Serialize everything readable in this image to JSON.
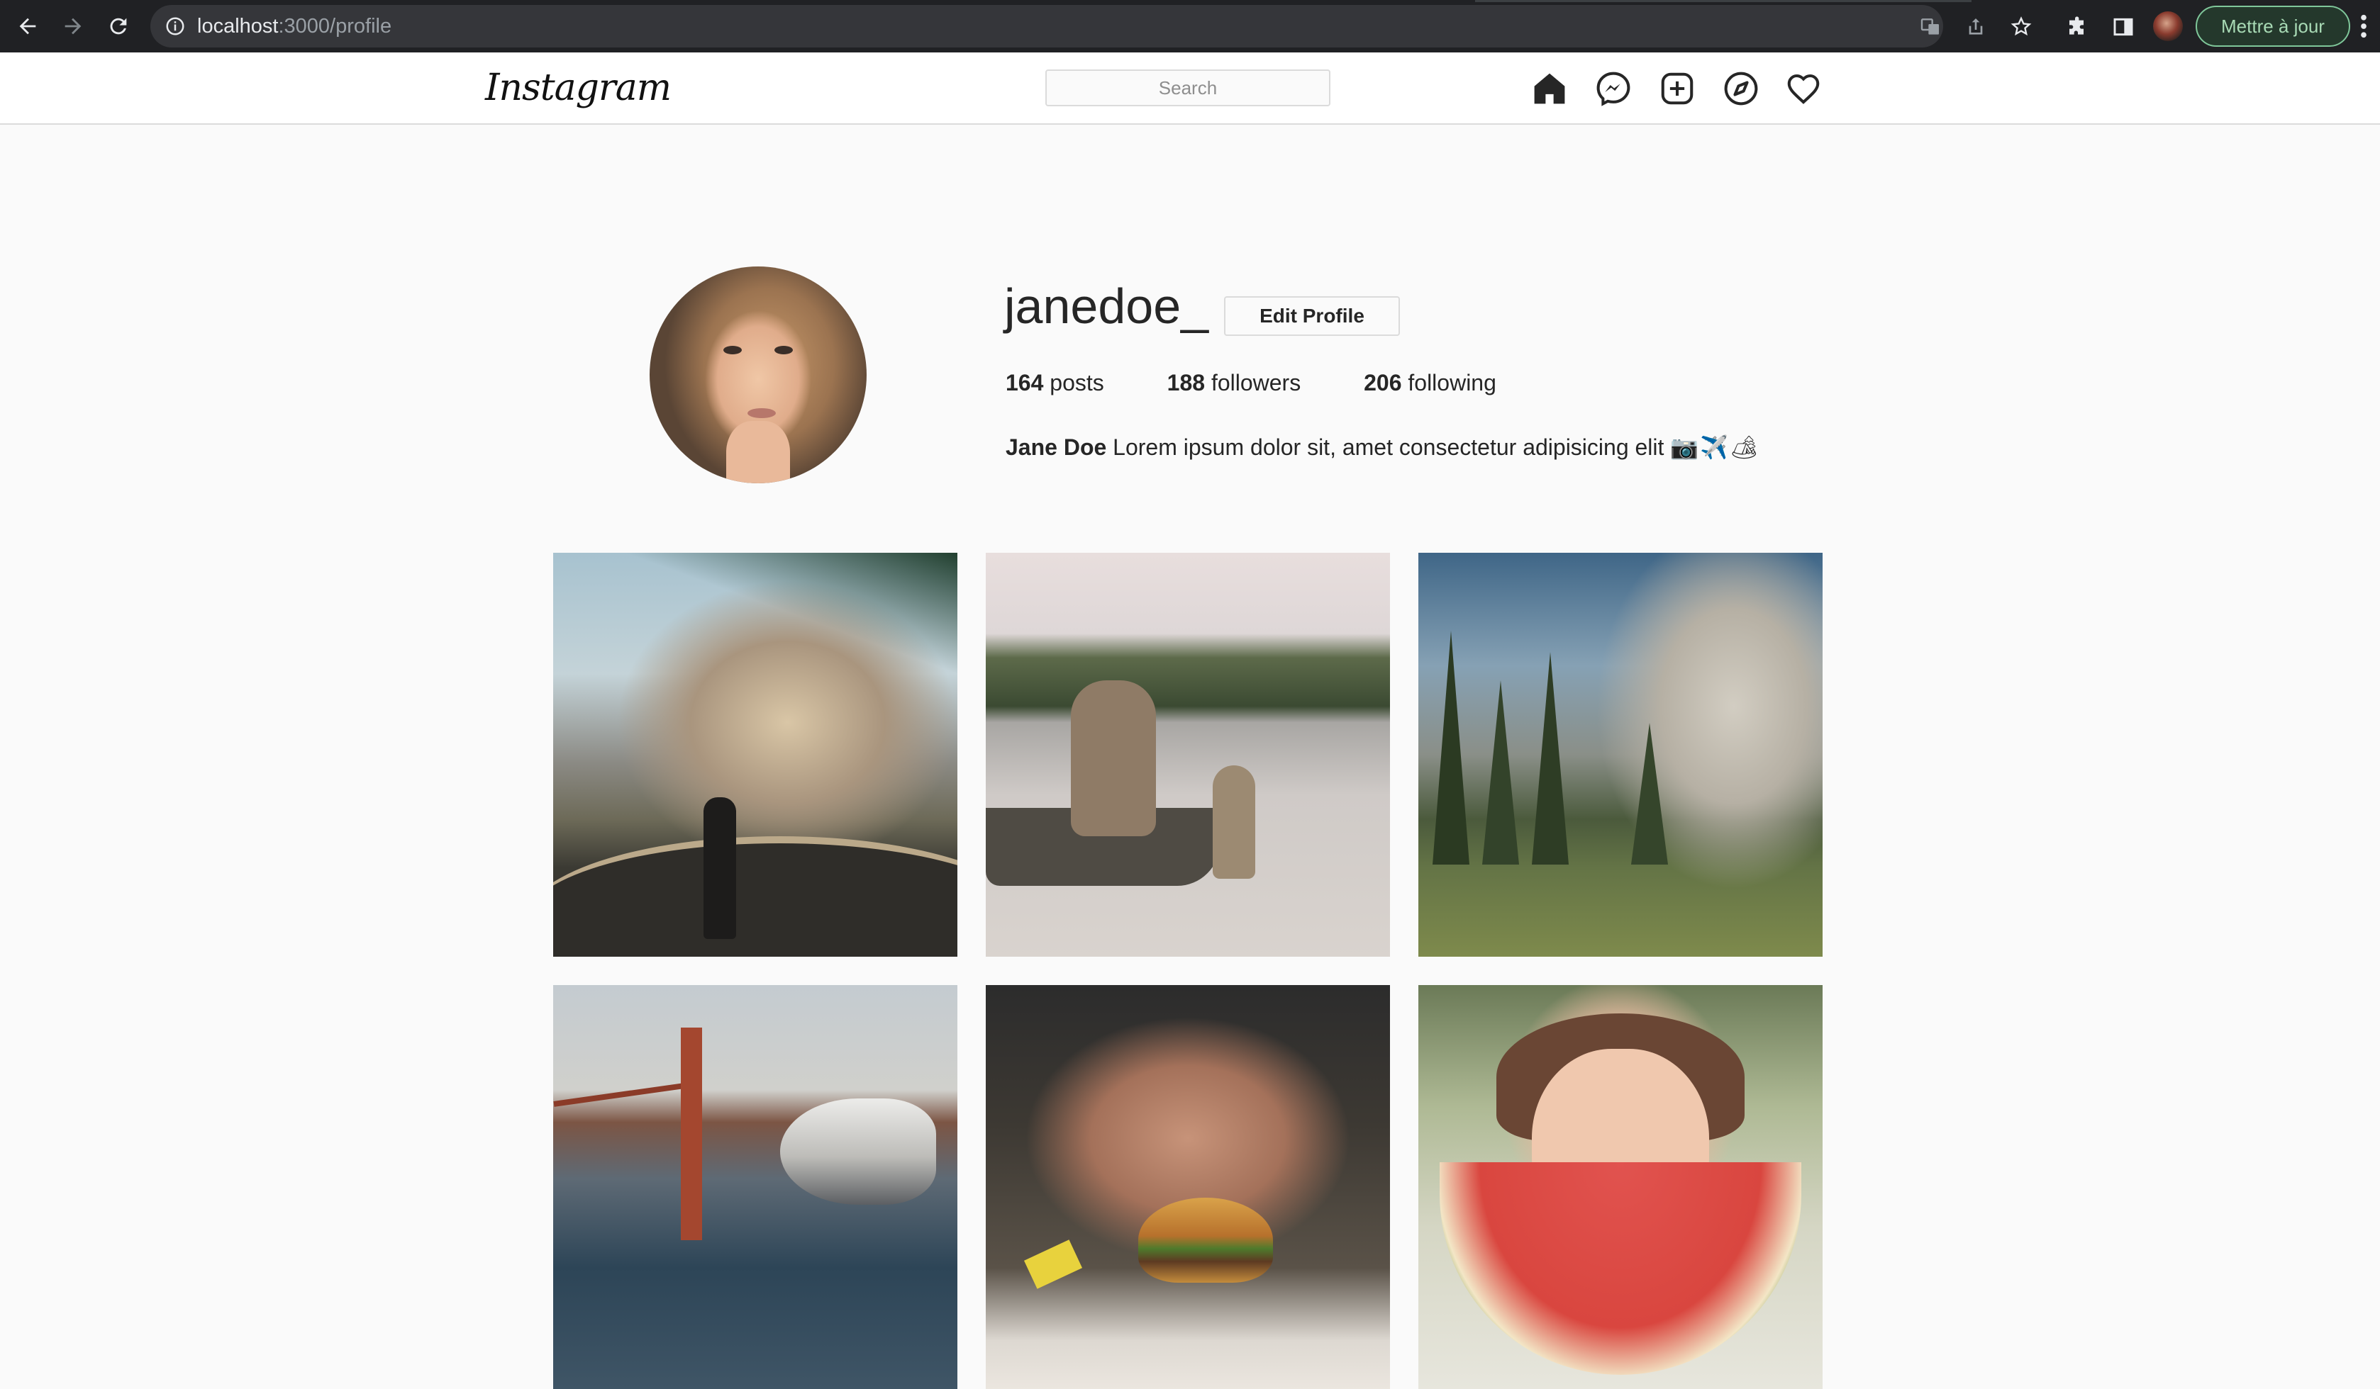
{
  "browser": {
    "url_host": "localhost",
    "url_rest": ":3000/profile",
    "update_button": "Mettre à jour"
  },
  "header": {
    "logo": "Instagram",
    "search_placeholder": "Search"
  },
  "profile": {
    "username": "janedoe_",
    "edit_button": "Edit Profile",
    "stats": [
      {
        "count": "164",
        "label": " posts"
      },
      {
        "count": "188",
        "label": " followers"
      },
      {
        "count": "206",
        "label": " following"
      }
    ],
    "display_name": "Jane Doe",
    "bio": " Lorem ipsum dolor sit, amet consectetur adipisicing elit ",
    "bio_emojis": "📷✈️🏕"
  },
  "photos": [
    {
      "subject": "hiker-on-road-half-dome"
    },
    {
      "subject": "mother-child-lake-boat"
    },
    {
      "subject": "el-capitan-meadow"
    },
    {
      "subject": "seagull-golden-gate"
    },
    {
      "subject": "man-with-burger"
    },
    {
      "subject": "woman-watermelon-smile"
    }
  ],
  "colors": {
    "chrome_bg": "#202124",
    "page_bg": "#fafafa",
    "border": "#dbdbdb",
    "text": "#262626",
    "update_accent": "#7fc79a"
  }
}
